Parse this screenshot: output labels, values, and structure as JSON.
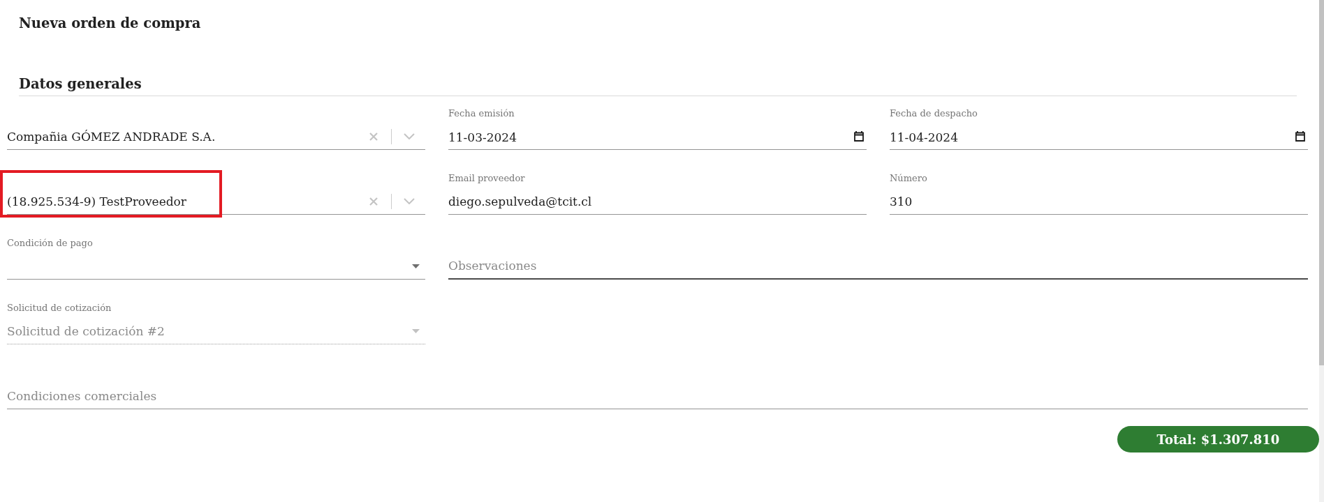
{
  "page": {
    "title": "Nueva orden de compra"
  },
  "section": {
    "title": "Datos generales"
  },
  "rows": [
    {
      "fields": [
        {
          "kind": "autocomplete",
          "value": "Compañia GÓMEZ ANDRADE S.A.",
          "disabled": false,
          "hovered": false,
          "highlighted": false
        },
        {
          "kind": "date",
          "label": "Fecha emisión",
          "value": "11-03-2024",
          "disabled": false,
          "hovered": false,
          "highlighted": false
        },
        {
          "kind": "date",
          "label": "Fecha de despacho",
          "value": "11-04-2024",
          "disabled": false,
          "hovered": false,
          "highlighted": false
        }
      ]
    },
    {
      "fields": [
        {
          "kind": "autocomplete",
          "value": "(18.925.534-9) TestProveedor",
          "disabled": false,
          "hovered": false,
          "highlighted": true
        },
        {
          "kind": "text",
          "label": "Email proveedor",
          "value": "diego.sepulveda@tcit.cl",
          "disabled": false,
          "hovered": false,
          "highlighted": false
        },
        {
          "kind": "text",
          "label": "Número",
          "value": "310",
          "disabled": false,
          "hovered": false,
          "highlighted": false
        }
      ]
    },
    {
      "fields": [
        {
          "kind": "select",
          "label": "Condición de pago",
          "disabled": false,
          "hovered": false,
          "highlighted": false
        },
        {
          "kind": "textarea",
          "placeholder": "Observaciones",
          "disabled": false,
          "hovered": true,
          "highlighted": false
        }
      ]
    },
    {
      "fields": [
        {
          "kind": "select",
          "label": "Solicitud de cotización",
          "value": "Solicitud de cotización #2",
          "disabled": true,
          "hovered": false,
          "highlighted": false
        }
      ]
    },
    {
      "fields": [
        {
          "kind": "textarea",
          "placeholder": "Condiciones comerciales",
          "disabled": false,
          "hovered": false,
          "highlighted": false
        }
      ]
    }
  ],
  "total": {
    "label": "Total: $1.307.810"
  }
}
